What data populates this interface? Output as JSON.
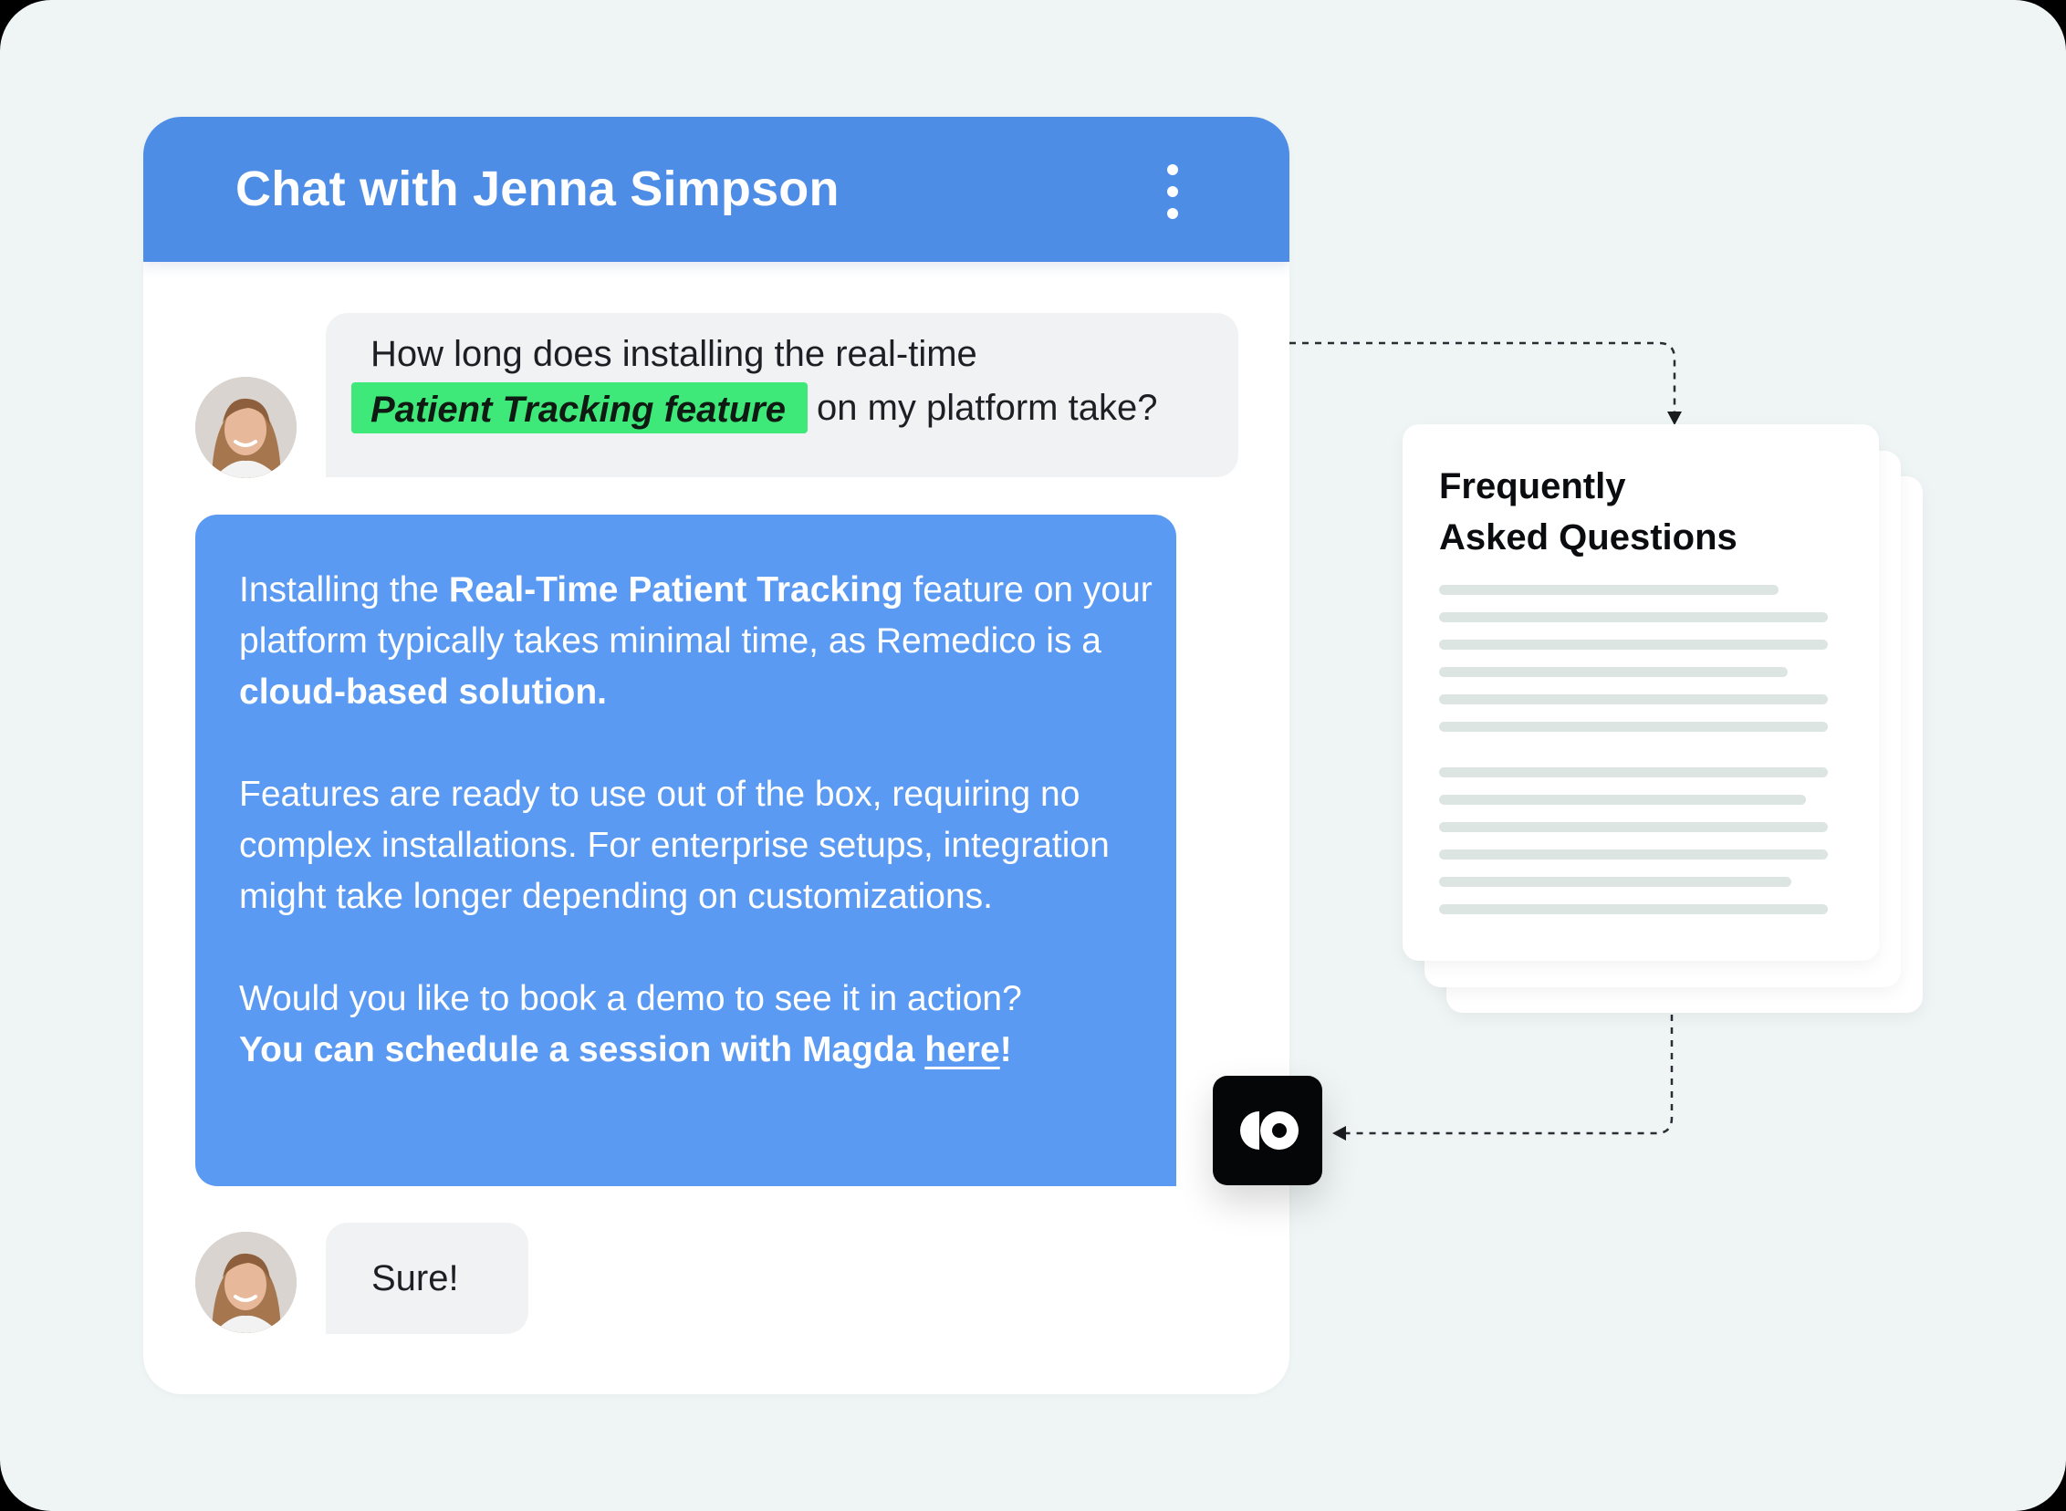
{
  "chat": {
    "title": "Chat with Jenna Simpson",
    "menu_icon": "more-vertical-icon",
    "user_question": {
      "line1": "How long does installing the real-time",
      "highlight": "Patient Tracking feature",
      "line2_rest": "on my platform take?"
    },
    "bot_reply": {
      "p1_pre": "Installing the ",
      "p1_bold1": "Real-Time Patient Tracking",
      "p1_mid": " feature on your platform typically takes minimal time, as Remedico is a ",
      "p1_bold2": "cloud-based solution.",
      "p2": "Features are ready to use out of the box, requiring no complex installations. For enterprise setups, integration might take longer depending on customizations.",
      "p3_pre": "Would you like to book a demo to see it in action?",
      "p3_bold": "You can schedule a session with Magda ",
      "p3_link": "here",
      "p3_end": "!"
    },
    "user_reply": "Sure!"
  },
  "faq": {
    "title_line1": "Frequently",
    "title_line2": "Asked Questions"
  },
  "colors": {
    "background": "#eff5f5",
    "header": "#4e8de6",
    "bot_bubble": "#5b9af2",
    "user_bubble": "#f1f2f4",
    "highlight": "#3ee97a",
    "logo_badge": "#050608"
  },
  "icons": {
    "avatar": "user-avatar-photo",
    "logo": "brand-logo-icon"
  }
}
